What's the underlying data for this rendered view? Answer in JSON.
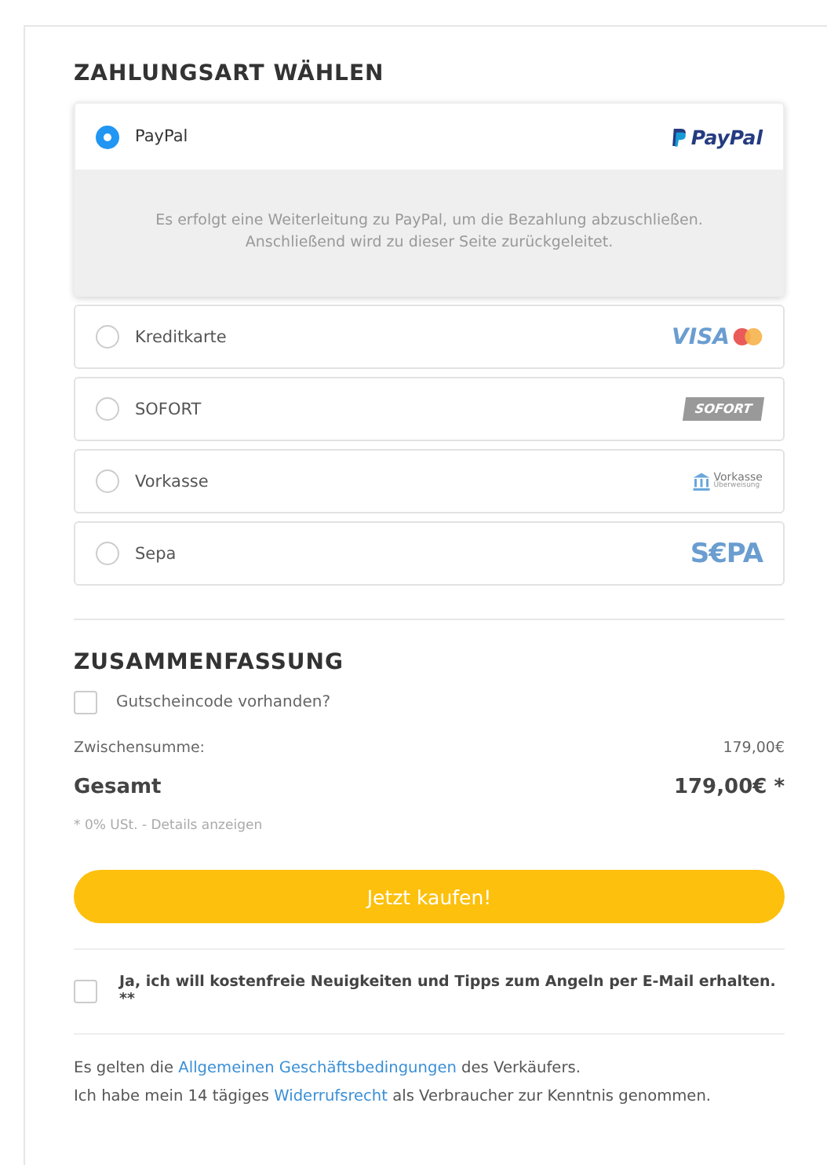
{
  "payment": {
    "title": "ZAHLUNGSART WÄHLEN",
    "methods": [
      {
        "label": "PayPal",
        "selected": true,
        "kind": "paypal",
        "logo": "PayPal",
        "description": [
          "Es erfolgt eine Weiterleitung zu PayPal, um die Bezahlung abzuschließen.",
          "Anschließend wird zu dieser Seite zurückgeleitet."
        ]
      },
      {
        "label": "Kreditkarte",
        "selected": false,
        "kind": "visa",
        "logo": "VISA"
      },
      {
        "label": "SOFORT",
        "selected": false,
        "kind": "sofort",
        "logo": "SOFORT"
      },
      {
        "label": "Vorkasse",
        "selected": false,
        "kind": "vorkasse",
        "logo": "Vorkasse",
        "logo_sub": "Überweisung"
      },
      {
        "label": "Sepa",
        "selected": false,
        "kind": "sepa",
        "logo": "S€PA"
      }
    ]
  },
  "summary": {
    "title": "ZUSAMMENFASSUNG",
    "voucher": {
      "label": "Gutscheincode vorhanden?",
      "checked": false
    },
    "subtotal": {
      "label": "Zwischensumme:",
      "value": "179,00€"
    },
    "total": {
      "label": "Gesamt",
      "value": "179,00€ *"
    },
    "tax_note": "* 0% USt. - Details anzeigen",
    "buy_button": "Jetzt kaufen!",
    "newsletter": {
      "label": "Ja, ich will kostenfreie Neuigkeiten und Tipps zum Angeln per E-Mail erhalten. **",
      "checked": false
    },
    "legal": [
      {
        "before": "Es gelten die ",
        "link": "Allgemeinen Geschäftsbedingungen",
        "after": " des Verkäufers."
      },
      {
        "before": "Ich habe mein 14 tägiges ",
        "link": "Widerrufsrecht",
        "after": " als Verbraucher zur Kenntnis genommen."
      }
    ]
  }
}
